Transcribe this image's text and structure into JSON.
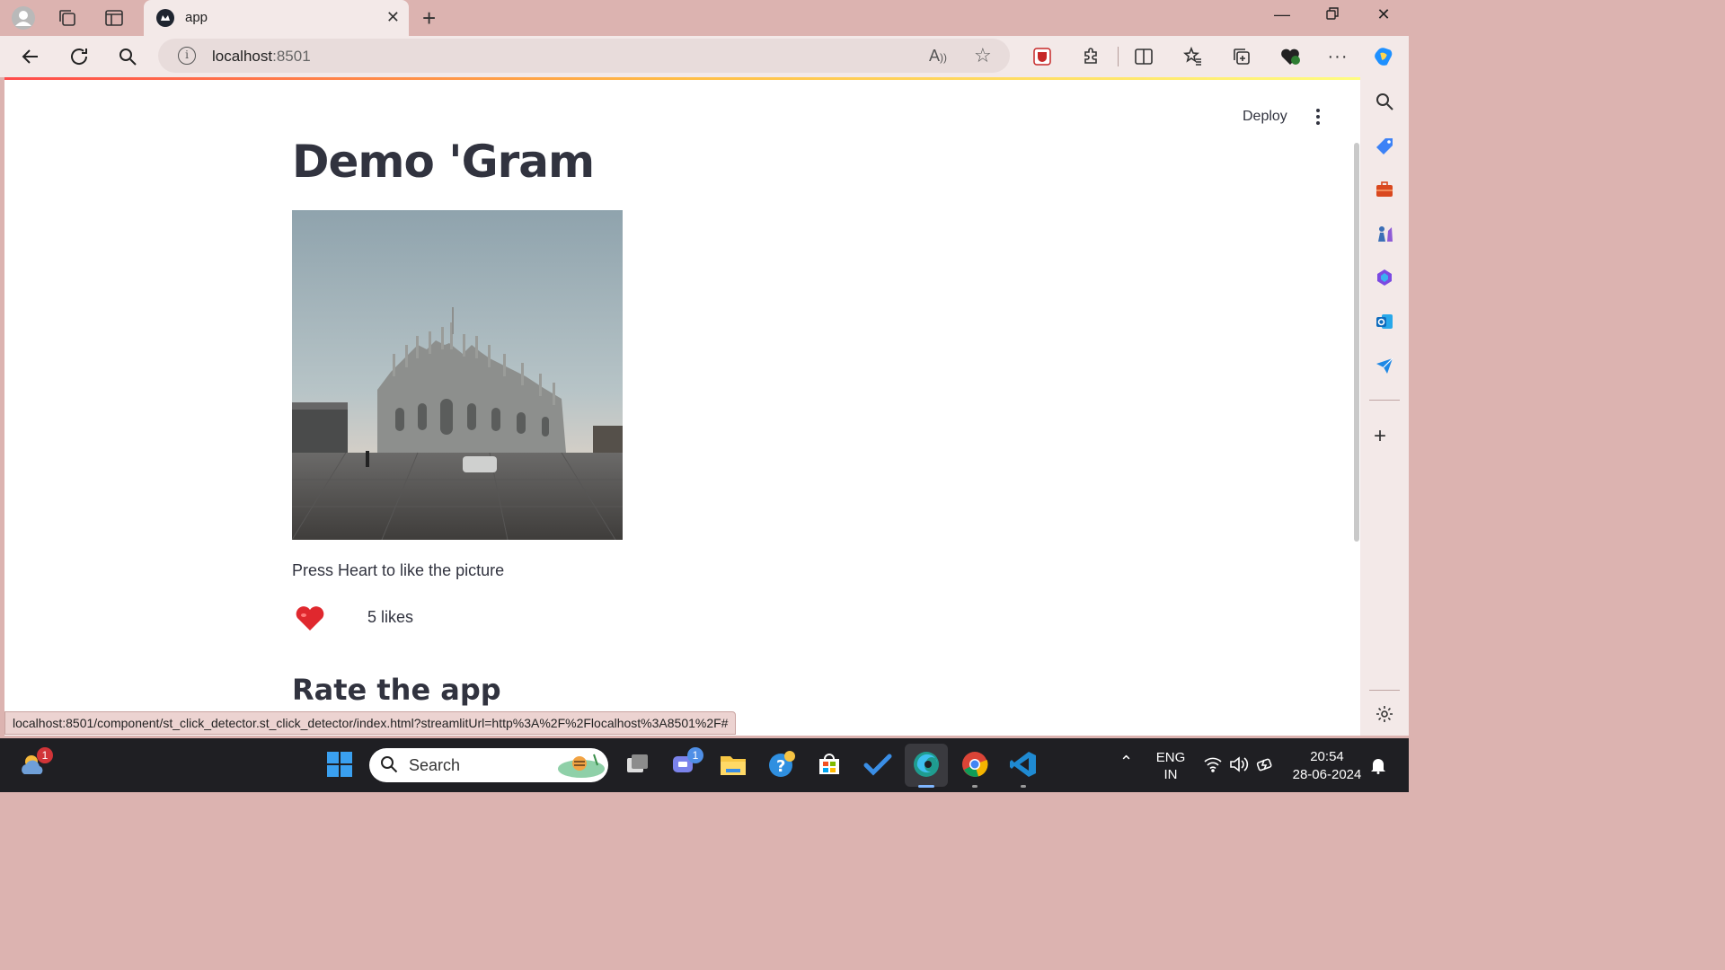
{
  "browser": {
    "tab_title": "app",
    "url_host": "localhost",
    "url_port": ":8501",
    "status_url": "localhost:8501/component/st_click_detector.st_click_detector/index.html?streamlitUrl=http%3A%2F%2Flocalhost%3A8501%2F#"
  },
  "app": {
    "deploy_label": "Deploy",
    "title": "Demo 'Gram",
    "caption": "Press Heart to like the picture",
    "likes_text": "5 likes",
    "subheading": "Rate the app"
  },
  "taskbar": {
    "search_placeholder": "Search",
    "weather_badge": "1",
    "teams_badge": "1",
    "lang_top": "ENG",
    "lang_bottom": "IN",
    "time": "20:54",
    "date": "28-06-2024"
  },
  "colors": {
    "streamlit_accent": "#ff4b4b",
    "text": "#31333f",
    "chrome_bg": "#dcb3b0"
  }
}
